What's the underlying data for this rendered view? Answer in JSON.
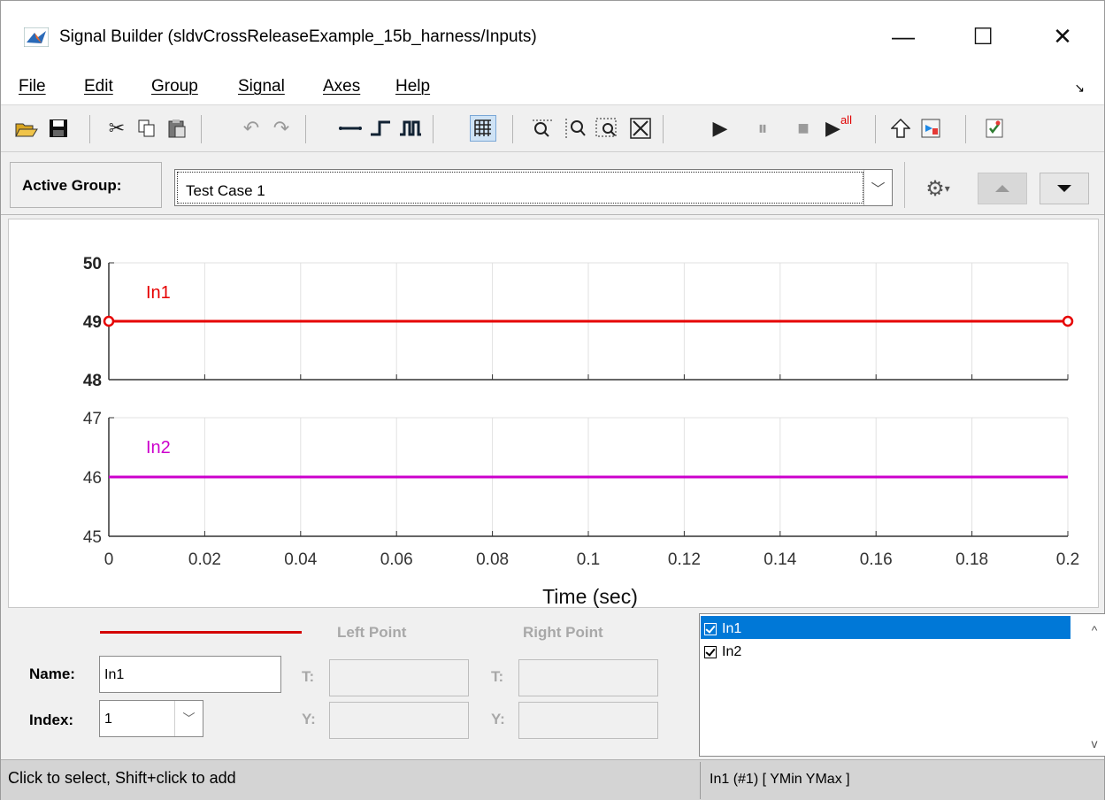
{
  "window": {
    "title": "Signal Builder (sldvCrossReleaseExample_15b_harness/Inputs)",
    "minimize": "—",
    "maximize": "☐",
    "close": "✕"
  },
  "menu": {
    "items": [
      "File",
      "Edit",
      "Group",
      "Signal",
      "Axes",
      "Help"
    ],
    "corner": "↘"
  },
  "toolbar": {
    "icons": [
      "open-icon",
      "save-icon",
      "cut-icon",
      "copy-icon",
      "paste-icon",
      "undo-icon",
      "redo-icon",
      "constant-icon",
      "step-icon",
      "pulse-icon",
      "grid-icon",
      "zoom-x-icon",
      "zoom-y-icon",
      "zoom-xy-icon",
      "fit-view-icon",
      "play-icon",
      "pause-icon",
      "stop-icon",
      "play-all-icon",
      "upload-icon",
      "open-model-icon",
      "verify-icon"
    ],
    "play_all_label": "all"
  },
  "group": {
    "label": "Active Group:",
    "value": "Test Case 1"
  },
  "plot": {
    "xlabel": "Time (sec)",
    "x_ticks": [
      "0",
      "0.02",
      "0.04",
      "0.06",
      "0.08",
      "0.1",
      "0.12",
      "0.14",
      "0.16",
      "0.18",
      "0.2"
    ],
    "colors": {
      "in1": "#e60000",
      "in2": "#cc00cc"
    }
  },
  "chart_data": [
    {
      "type": "line",
      "series": [
        {
          "name": "In1",
          "x": [
            0,
            0.2
          ],
          "y": [
            49,
            49
          ]
        }
      ],
      "ylim": [
        48,
        50
      ],
      "y_ticks": [
        "50",
        "49",
        "48"
      ],
      "xlim": [
        0,
        0.2
      ],
      "grid": true
    },
    {
      "type": "line",
      "series": [
        {
          "name": "In2",
          "x": [
            0,
            0.2
          ],
          "y": [
            46,
            46
          ]
        }
      ],
      "ylim": [
        45,
        47
      ],
      "y_ticks": [
        "47",
        "46",
        "45"
      ],
      "xlim": [
        0,
        0.2
      ],
      "grid": true
    }
  ],
  "editor": {
    "left_point": "Left Point",
    "right_point": "Right Point",
    "name_label": "Name:",
    "name_value": "In1",
    "index_label": "Index:",
    "index_value": "1",
    "t_label": "T:",
    "y_label": "Y:"
  },
  "signals": {
    "items": [
      {
        "label": "In1",
        "selected": true
      },
      {
        "label": "In2",
        "selected": false
      }
    ],
    "scroll_up": "^",
    "scroll_down": "v"
  },
  "status": {
    "left": "Click to select, Shift+click to add",
    "right": "In1 (#1)  [ YMin YMax ]"
  }
}
